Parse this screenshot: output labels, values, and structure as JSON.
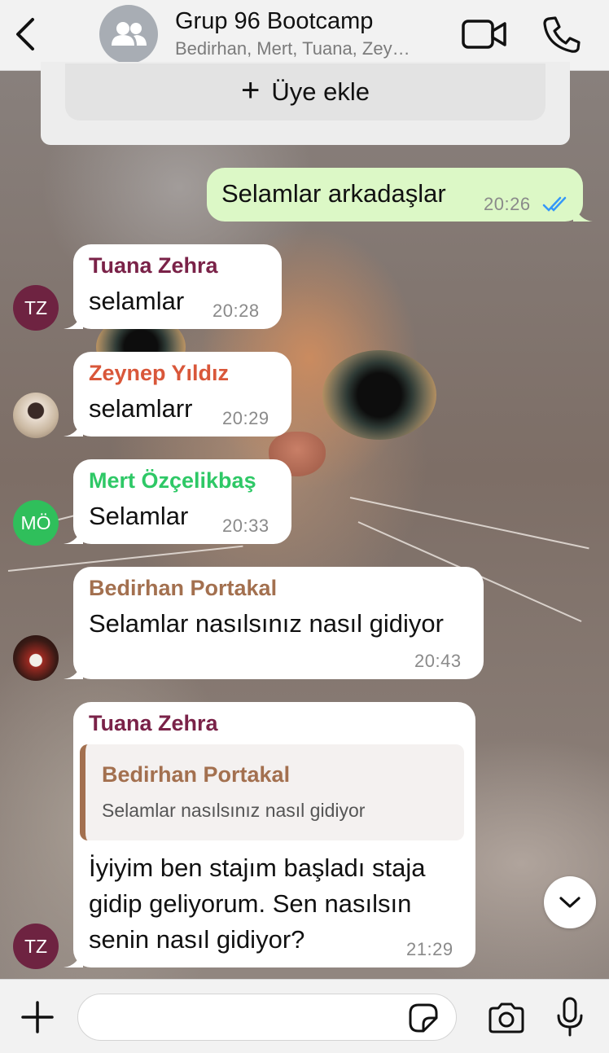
{
  "header": {
    "title": "Grup 96 Bootcamp",
    "subtitle": "Bedirhan, Mert, Tuana, Zey…",
    "back_icon": "chevron-left-icon",
    "video_icon": "video-camera-icon",
    "call_icon": "phone-icon"
  },
  "info": {
    "add_member_label": "Üye ekle"
  },
  "messages": [
    {
      "type": "outgoing",
      "text": "Selamlar arkadaşlar",
      "time": "20:26",
      "status": "read"
    },
    {
      "type": "incoming",
      "sender": "Tuana Zehra",
      "sender_color": "#7a2248",
      "avatar": "TZ",
      "avatar_color": "#6e2341",
      "text": "selamlar",
      "time": "20:28"
    },
    {
      "type": "incoming",
      "sender": "Zeynep Yıldız",
      "sender_color": "#d9573a",
      "avatar_photo": true,
      "text": "selamlarr",
      "time": "20:29"
    },
    {
      "type": "incoming",
      "sender": "Mert Özçelikbaş",
      "sender_color": "#2ec866",
      "avatar": "MÖ",
      "avatar_color": "#2fbf5b",
      "text": "Selamlar",
      "time": "20:33"
    },
    {
      "type": "incoming",
      "sender": "Bedirhan Portakal",
      "sender_color": "#a3704f",
      "avatar_photo": true,
      "text": "Selamlar nasılsınız nasıl gidiyor",
      "time": "20:43"
    },
    {
      "type": "incoming",
      "sender": "Tuana Zehra",
      "sender_color": "#7a2248",
      "avatar": "TZ",
      "avatar_color": "#6e2341",
      "quote": {
        "sender": "Bedirhan Portakal",
        "text": "Selamlar nasılsınız nasıl gidiyor"
      },
      "lines": [
        "İyiyim ben stajım başladı staja",
        "gidip geliyorum. Sen nasılsın",
        "senin nasıl gidiyor?"
      ],
      "time": "21:29"
    }
  ],
  "footer": {
    "input_placeholder": "",
    "attach_icon": "plus-icon",
    "sticker_icon": "sticker-icon",
    "camera_icon": "camera-icon",
    "mic_icon": "microphone-icon"
  },
  "colors": {
    "outgoing_bubble": "#dcf8c6",
    "incoming_bubble": "#ffffff",
    "read_ticks": "#3497f9"
  }
}
